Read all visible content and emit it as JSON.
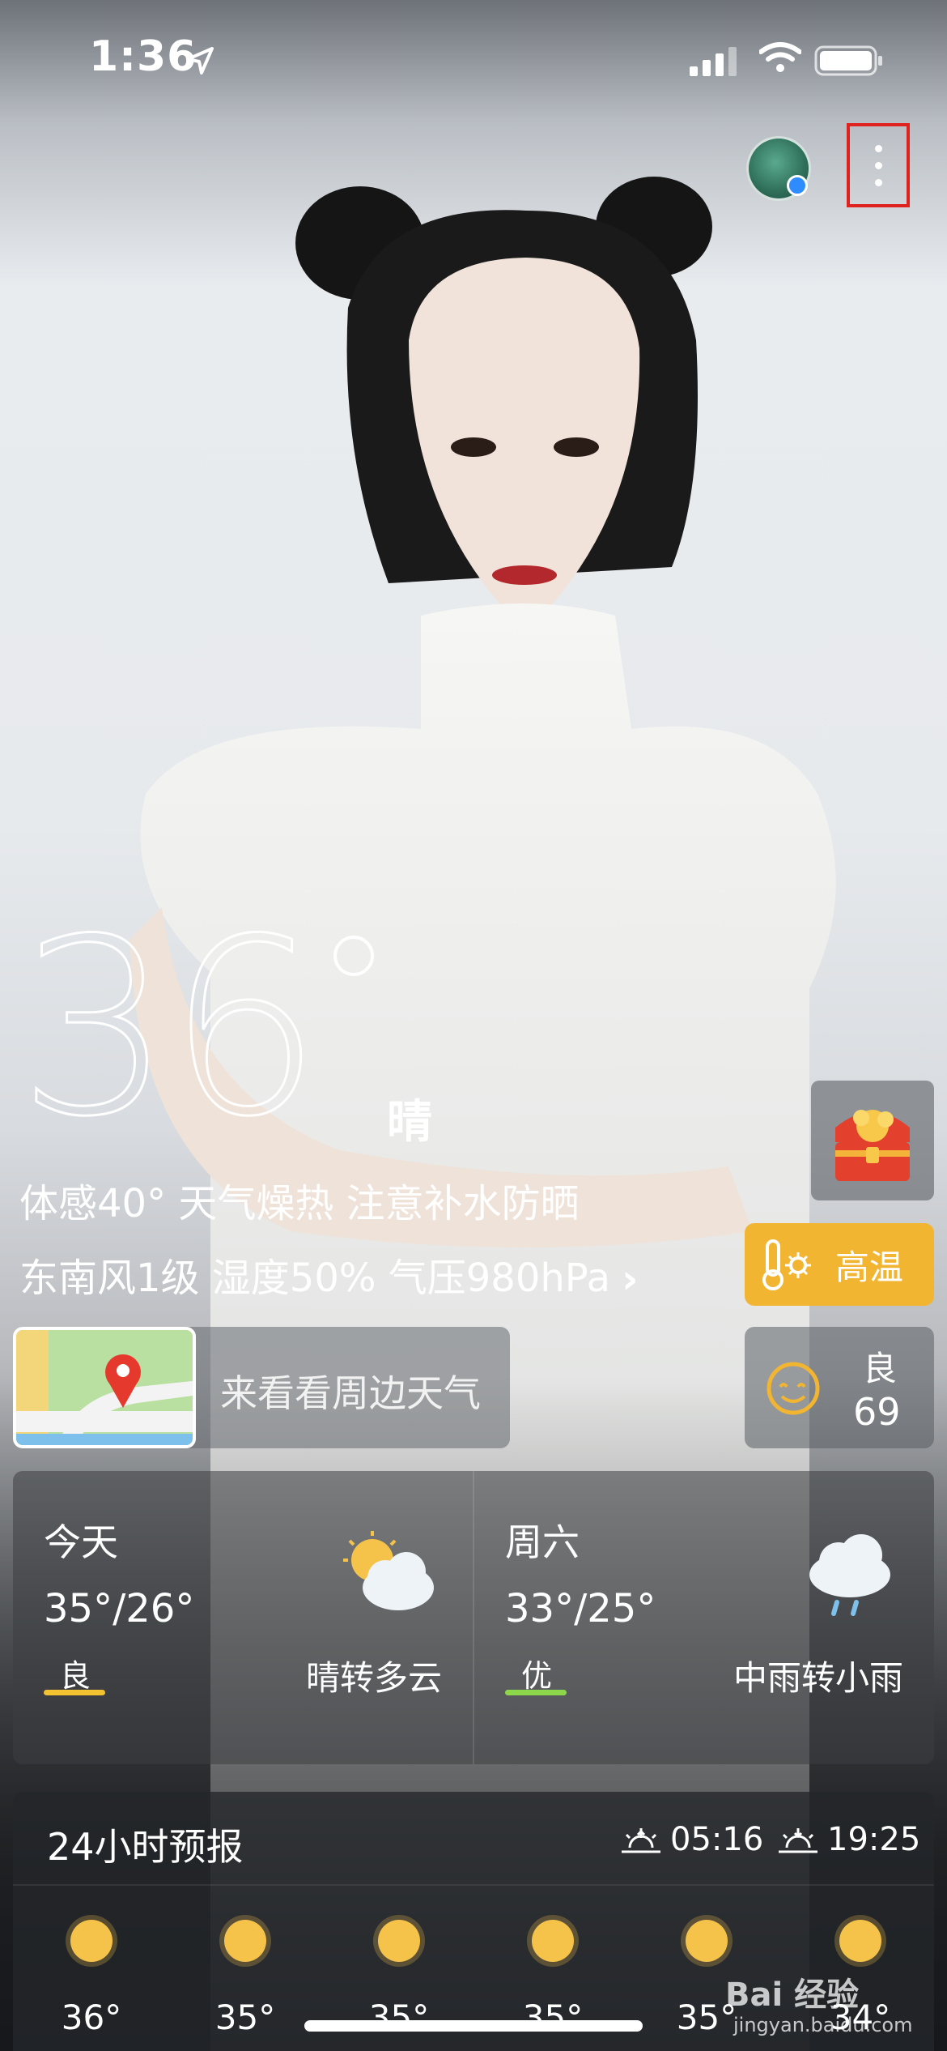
{
  "status": {
    "time": "1:36"
  },
  "current": {
    "temperature": "36",
    "condition": "晴",
    "feel_line": "体感40° 天气燥热 注意补水防晒",
    "wind_line": "东南风1级 湿度50% 气压980hPa",
    "chevron": "›"
  },
  "alerts": {
    "heat_label": "高温"
  },
  "aqi": {
    "level": "良",
    "value": "69"
  },
  "map_card": {
    "label": "来看看周边天气"
  },
  "forecast": [
    {
      "day": "今天",
      "range": "35°/26°",
      "air": "良",
      "air_color": "#f2c230",
      "condition": "晴转多云",
      "icon": "sun-cloud-icon"
    },
    {
      "day": "周六",
      "range": "33°/25°",
      "air": "优",
      "air_color": "#8cd84a",
      "condition": "中雨转小雨",
      "icon": "rain-cloud-icon"
    }
  ],
  "hourly": {
    "title": "24小时预报",
    "sunrise": "05:16",
    "sunset": "19:25",
    "hours": [
      {
        "temp": "36°"
      },
      {
        "temp": "35°"
      },
      {
        "temp": "35°"
      },
      {
        "temp": "35°"
      },
      {
        "temp": "35°"
      },
      {
        "temp": "34°"
      }
    ]
  },
  "watermark": {
    "brand": "Bai 经验",
    "url": "jingyan.baidu.com"
  }
}
